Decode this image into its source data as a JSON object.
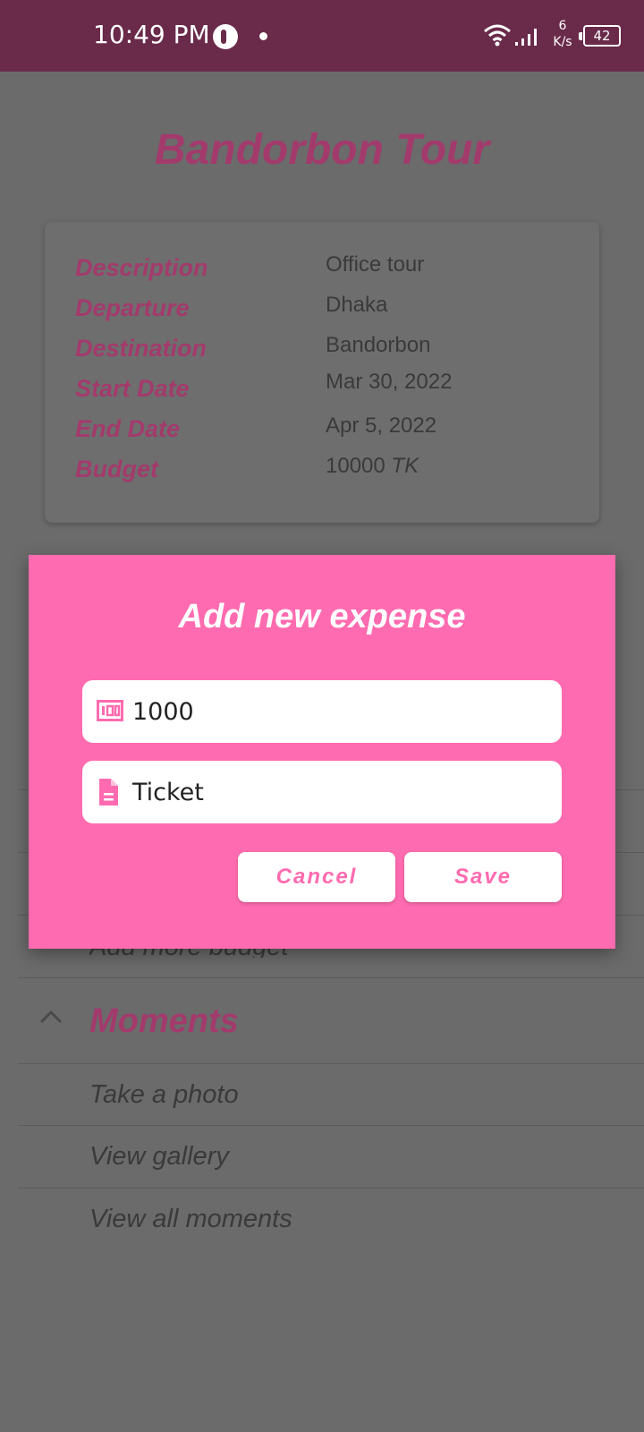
{
  "status_bar": {
    "time": "10:49 PM",
    "net_speed_value": "6",
    "net_speed_unit": "K/s",
    "battery": "42"
  },
  "page": {
    "title": "Bandorbon Tour"
  },
  "details": [
    {
      "label": "Description",
      "value": "Office tour"
    },
    {
      "label": "Departure",
      "value": "Dhaka"
    },
    {
      "label": "Destination",
      "value": "Bandorbon"
    },
    {
      "label": "Start Date",
      "value": "Mar 30, 2022"
    },
    {
      "label": "End Date",
      "value": "Apr 5, 2022"
    },
    {
      "label": "Budget",
      "value": "10000",
      "unit": "TK"
    }
  ],
  "background_list": {
    "budget_partial": "Add more budget",
    "moments_header": "Moments",
    "moments_items": [
      "Take a photo",
      "View gallery",
      "View all moments"
    ]
  },
  "dialog": {
    "title": "Add new expense",
    "amount_value": "1000",
    "note_value": "Ticket",
    "cancel_label": "Cancel",
    "save_label": "Save"
  },
  "icons": {
    "amount": "money-icon",
    "note": "document-icon",
    "chevron": "chevron-up-icon"
  },
  "colors": {
    "accent": "#ff6bb0",
    "label": "#a33a6c",
    "status_bar": "#6a2a4a"
  }
}
